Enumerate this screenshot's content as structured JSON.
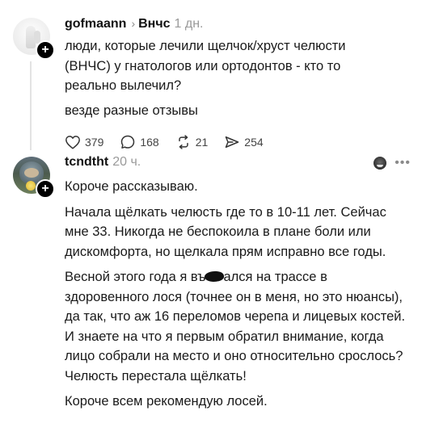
{
  "posts": [
    {
      "username": "gofmaann",
      "recipient": "Внчс",
      "time": "1 дн.",
      "text_lines": [
        "люди, которые лечили щелчок/хруст челюсти",
        "(ВНЧС) у гнатологов или ортодонтов - кто то",
        "реально вылечил?",
        "везде разные отзывы"
      ],
      "actions": {
        "likes": "379",
        "comments": "168",
        "reposts": "21",
        "shares": "254"
      },
      "icons": {
        "like": "heart-icon",
        "comment": "comment-icon",
        "repost": "repost-icon",
        "share": "share-icon"
      }
    },
    {
      "username": "tcndtht",
      "time": "20 ч.",
      "paragraphs": [
        "Короче рассказываю.",
        "Начала щёлкать челюсть где то в 10-11 лет. Сейчас мне 33. Никогда не беспокоила в плане боли или дискомфорта, но щелкала прям исправно все годы.",
        {
          "before": "Весной этого года я въ",
          "after": "ался на трассе в здоровенного лося (точнее он в меня, но это нюансы), да так, что аж 16 переломов черепа и лицевых костей. И знаете на что я первым обратил внимание, когда лицо собрали на место и оно относительно срослось? Челюсть перестала щёлкать!"
        },
        "Короче всем рекомендую лосей."
      ],
      "icons": {
        "reaction": "emoji-icon",
        "more": "more-icon"
      }
    }
  ],
  "colors": {
    "text": "#1a1a1a",
    "muted": "#9a9a9a",
    "background": "#ffffff",
    "badge": "#000000"
  }
}
